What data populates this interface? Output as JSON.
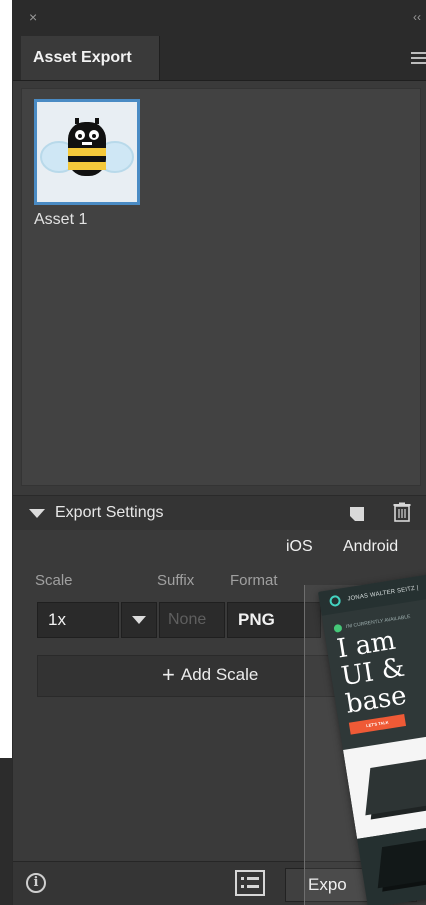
{
  "panel": {
    "tab_title": "Asset Export"
  },
  "assets": [
    {
      "label": "Asset 1"
    }
  ],
  "export_settings": {
    "title": "Export Settings",
    "platforms": [
      "iOS",
      "Android"
    ],
    "columns": {
      "scale": "Scale",
      "suffix": "Suffix",
      "format": "Format"
    },
    "row": {
      "scale": "1x",
      "suffix_placeholder": "None",
      "format": "PNG"
    },
    "add_scale_label": "Add Scale"
  },
  "bottom": {
    "export_button_label": "Expo"
  },
  "preview": {
    "nav_text": "JONAS WALTER SEITZ |",
    "small_text": "I'M CURRENTLY AVAILABLE",
    "hero_lines": [
      "I am",
      "UI &",
      "base"
    ],
    "cta_text": "LET'S TALK"
  },
  "colors": {
    "panel_bg": "#3a3a3a",
    "panel_dark": "#2b2b2b",
    "selection_blue": "#4a8bc4",
    "preview_accent": "#ef5a36",
    "preview_logo": "#43d3c1"
  }
}
